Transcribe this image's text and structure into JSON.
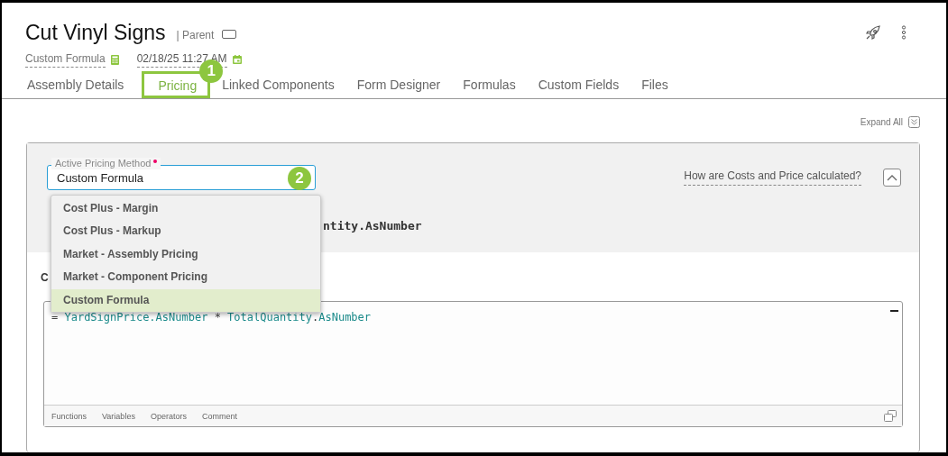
{
  "header": {
    "title": "Cut Vinyl Signs",
    "subtitle": "| Parent",
    "pricing_method": "Custom Formula",
    "timestamp": "02/18/25 11:27 AM"
  },
  "tabs": [
    {
      "label": "Assembly Details",
      "selected": false
    },
    {
      "label": "Pricing",
      "selected": true,
      "callout": "1"
    },
    {
      "label": "Linked Components",
      "selected": false
    },
    {
      "label": "Form Designer",
      "selected": false
    },
    {
      "label": "Formulas",
      "selected": false
    },
    {
      "label": "Custom Fields",
      "selected": false
    },
    {
      "label": "Files",
      "selected": false
    }
  ],
  "expand_all": "Expand All",
  "pricing": {
    "field_label": "Active Pricing Method",
    "required": true,
    "value": "Custom Formula",
    "callout": "2",
    "help_link": "How are Costs and Price calculated?",
    "expanded": true,
    "summary_fragment": "ntity.AsNumber",
    "formula_label_fragment": "C",
    "options": [
      {
        "label": "Cost Plus - Margin",
        "selected": false
      },
      {
        "label": "Cost Plus - Markup",
        "selected": false
      },
      {
        "label": "Market - Assembly Pricing",
        "selected": false
      },
      {
        "label": "Market - Component Pricing",
        "selected": false
      },
      {
        "label": "Custom Formula",
        "selected": true
      }
    ]
  },
  "editor": {
    "tokens": [
      {
        "text": "= ",
        "kind": "operator"
      },
      {
        "text": "YardSignPrice.AsNumber",
        "kind": "variable"
      },
      {
        "text": " * ",
        "kind": "operator"
      },
      {
        "text": "TotalQuantity",
        "kind": "variable"
      },
      {
        "text": ".",
        "kind": "punct"
      },
      {
        "text": "AsNumber",
        "kind": "variable"
      }
    ],
    "toolbar": [
      "Functions",
      "Variables",
      "Operators",
      "Comment"
    ]
  }
}
